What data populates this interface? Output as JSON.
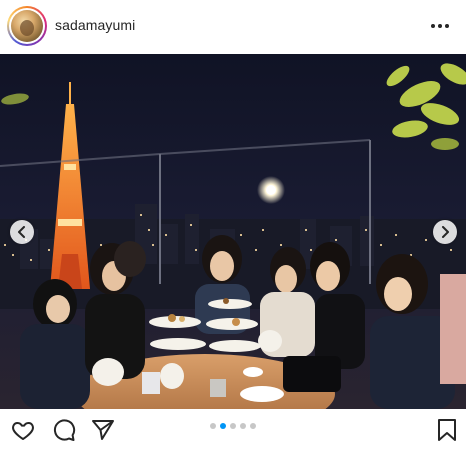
{
  "post": {
    "username": "sadamayumi",
    "avatar_icon": "profile-photo",
    "more_icon": "more-horizontal-icon"
  },
  "carousel": {
    "total_slides": 5,
    "active_slide": 2,
    "prev_icon": "chevron-left-icon",
    "next_icon": "chevron-right-icon",
    "active_color": "#0095f6",
    "inactive_color": "#c7c7c7"
  },
  "actions": {
    "like_icon": "heart-icon",
    "comment_icon": "comment-icon",
    "share_icon": "paper-plane-icon",
    "save_icon": "bookmark-icon"
  },
  "colors": {
    "text": "#262626",
    "photo_sky": "#0b0d1a",
    "tower": "#ff7a1a"
  }
}
